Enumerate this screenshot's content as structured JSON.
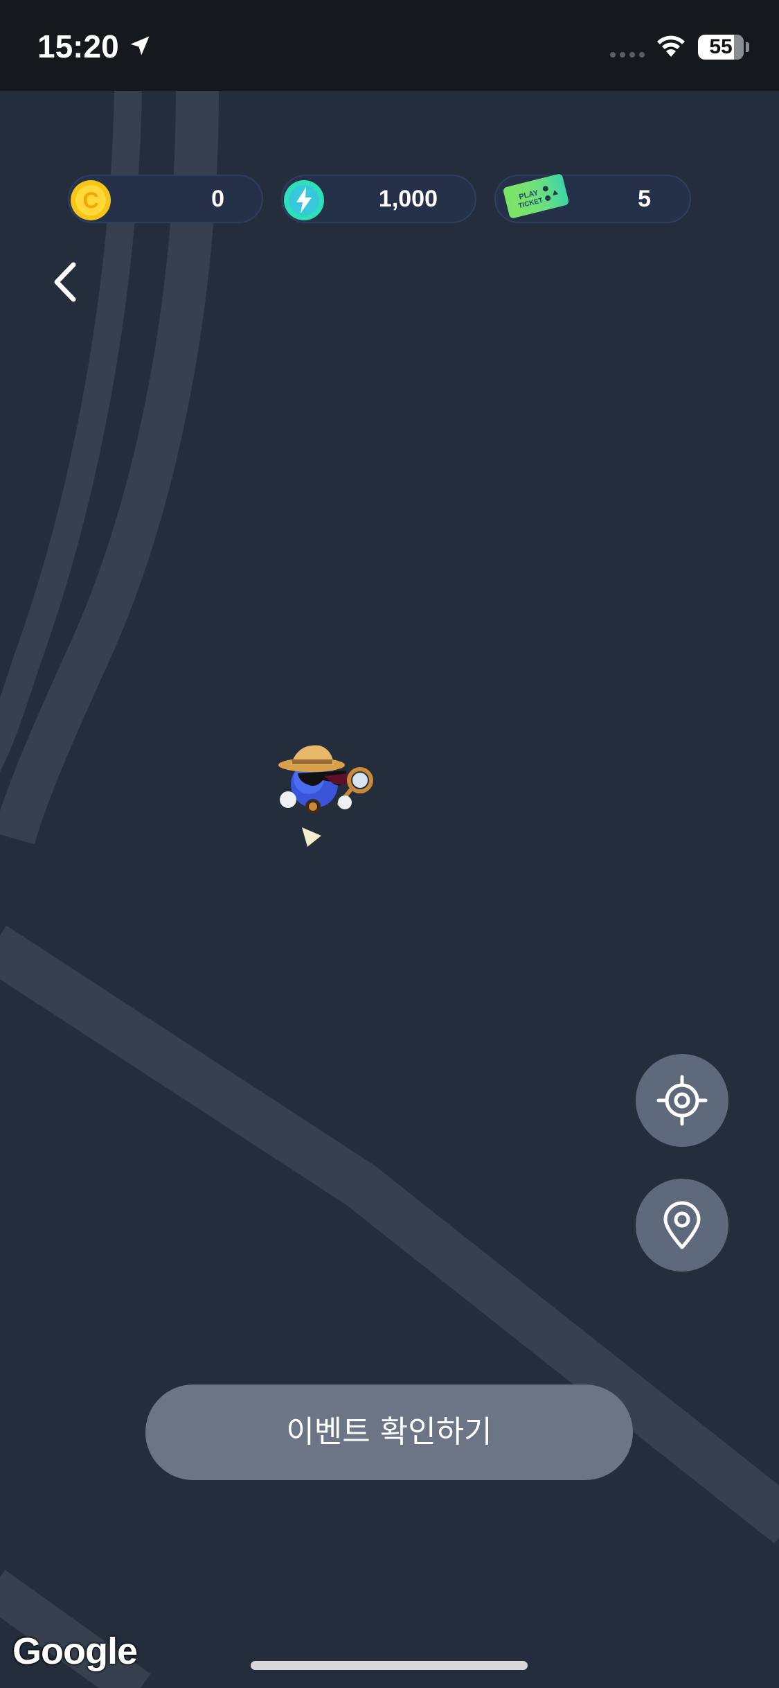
{
  "status_bar": {
    "time": "15:20",
    "battery_level": "55",
    "icons": [
      "location-arrow-icon",
      "signal-dots-icon",
      "wifi-icon",
      "battery-icon"
    ]
  },
  "currencies": {
    "coin": {
      "value": "0",
      "icon": "coin-icon",
      "icon_letter": "C",
      "color": "#f5c518"
    },
    "energy": {
      "value": "1,000",
      "icon": "energy-bolt-icon",
      "color": "#2ee0b8"
    },
    "ticket": {
      "value": "5",
      "icon": "play-ticket-icon",
      "icon_text_1": "PLAY",
      "icon_text_2": "TICKET",
      "color": "#7be36a"
    }
  },
  "navigation": {
    "back_icon": "chevron-left-icon"
  },
  "map": {
    "background_color": "#232d3b",
    "road_color": "#36404e",
    "character": "explorer-character-icon",
    "heading": "heading-arrow-icon"
  },
  "map_controls": {
    "recenter_icon": "crosshair-icon",
    "place_pin_icon": "map-pin-icon"
  },
  "event_button": {
    "label": "이벤트 확인하기"
  },
  "attribution": {
    "google": "Google"
  }
}
